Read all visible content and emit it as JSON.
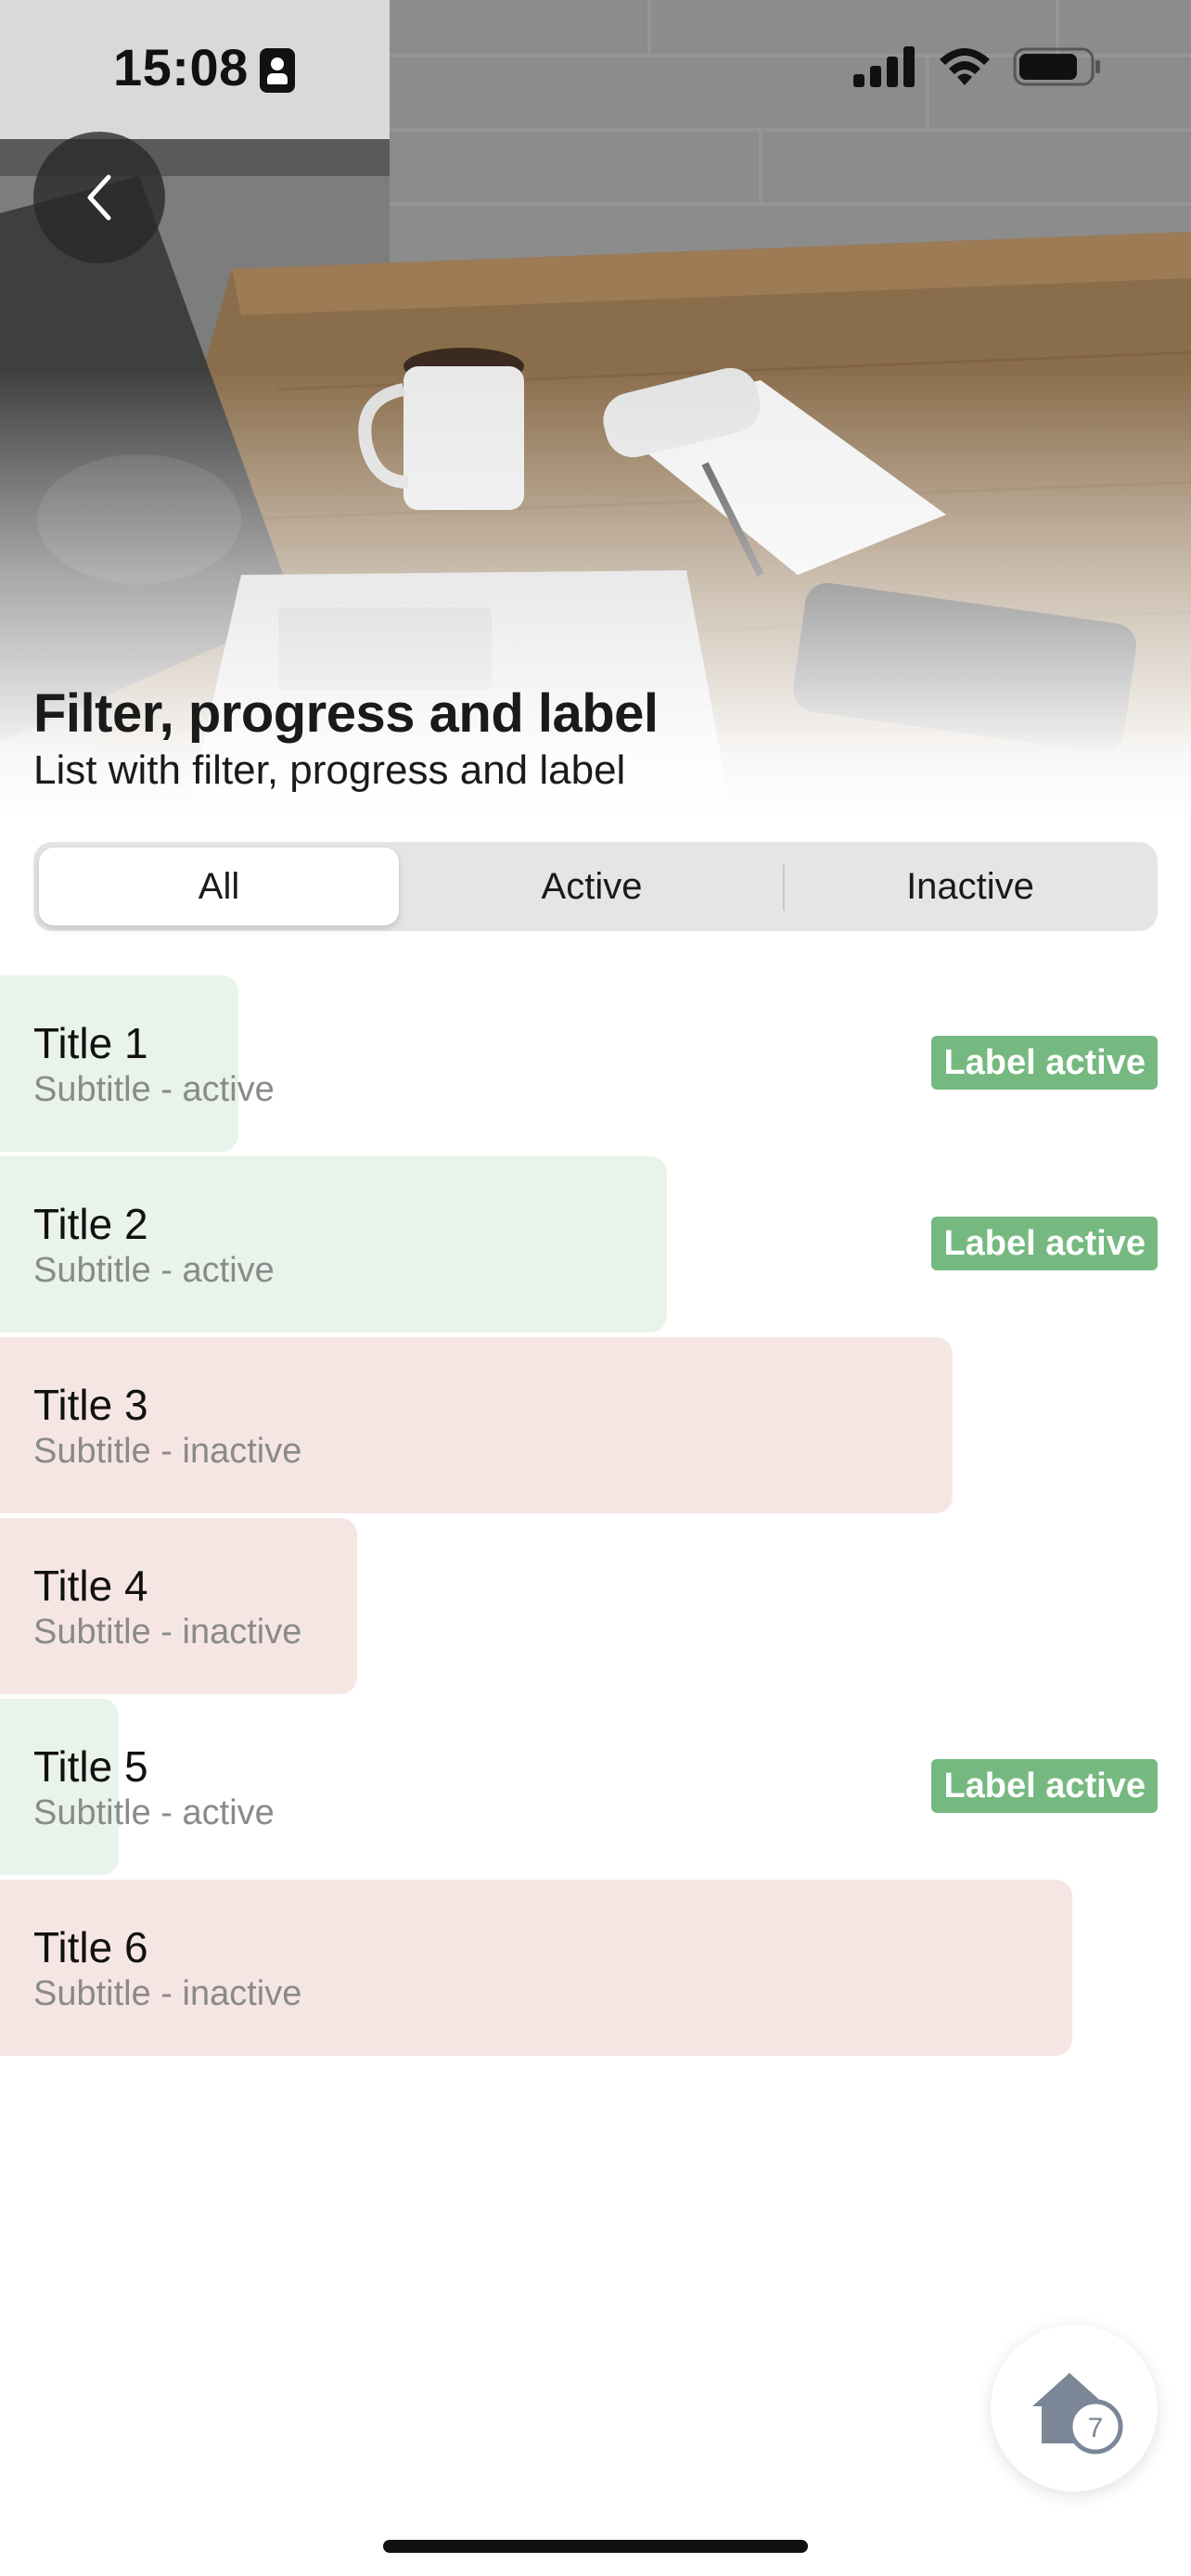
{
  "status_bar": {
    "time": "15:08"
  },
  "header": {
    "title": "Filter, progress and label",
    "subtitle": "List with filter, progress and label"
  },
  "filter": {
    "options": [
      "All",
      "Active",
      "Inactive"
    ],
    "selected": "All"
  },
  "colors": {
    "active_bar": "#e8f3ea",
    "inactive_bar": "#f6e6e3",
    "label_bg": "#76b980"
  },
  "items": [
    {
      "title": "Title 1",
      "subtitle": "Subtitle - active",
      "status": "active",
      "progress": 0.2,
      "label": "Label active"
    },
    {
      "title": "Title 2",
      "subtitle": "Subtitle - active",
      "status": "active",
      "progress": 0.56,
      "label": "Label active"
    },
    {
      "title": "Title 3",
      "subtitle": "Subtitle - inactive",
      "status": "inactive",
      "progress": 0.8,
      "label": ""
    },
    {
      "title": "Title 4",
      "subtitle": "Subtitle - inactive",
      "status": "inactive",
      "progress": 0.3,
      "label": ""
    },
    {
      "title": "Title 5",
      "subtitle": "Subtitle - active",
      "status": "active",
      "progress": 0.1,
      "label": "Label active"
    },
    {
      "title": "Title 6",
      "subtitle": "Subtitle - inactive",
      "status": "inactive",
      "progress": 0.9,
      "label": ""
    }
  ],
  "fab": {
    "icon": "home-icon",
    "badge": "7"
  }
}
